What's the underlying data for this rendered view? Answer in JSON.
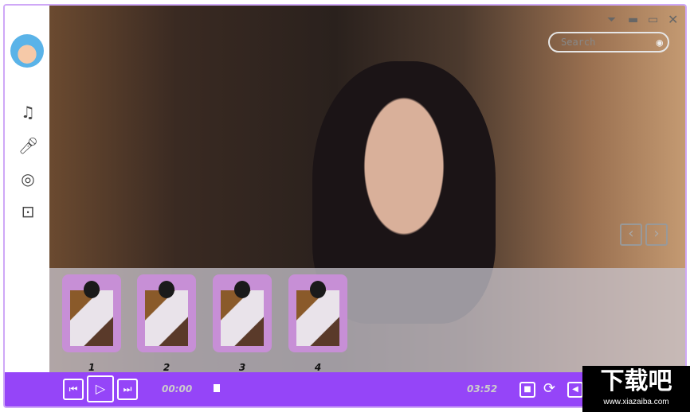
{
  "search": {
    "placeholder": "Search"
  },
  "sidebar": {
    "items": [
      {
        "name": "music"
      },
      {
        "name": "microphone"
      },
      {
        "name": "circles"
      },
      {
        "name": "radio"
      }
    ]
  },
  "albums": [
    {
      "label": "1"
    },
    {
      "label": "2"
    },
    {
      "label": "3"
    },
    {
      "label": "4"
    }
  ],
  "player": {
    "current_time": "00:00",
    "total_time": "03:52",
    "progress": 0
  },
  "watermark": {
    "text": "下载吧",
    "url": "www.xiazaiba.com"
  },
  "colors": {
    "accent": "#9545f8",
    "border": "#cfa8f7"
  }
}
